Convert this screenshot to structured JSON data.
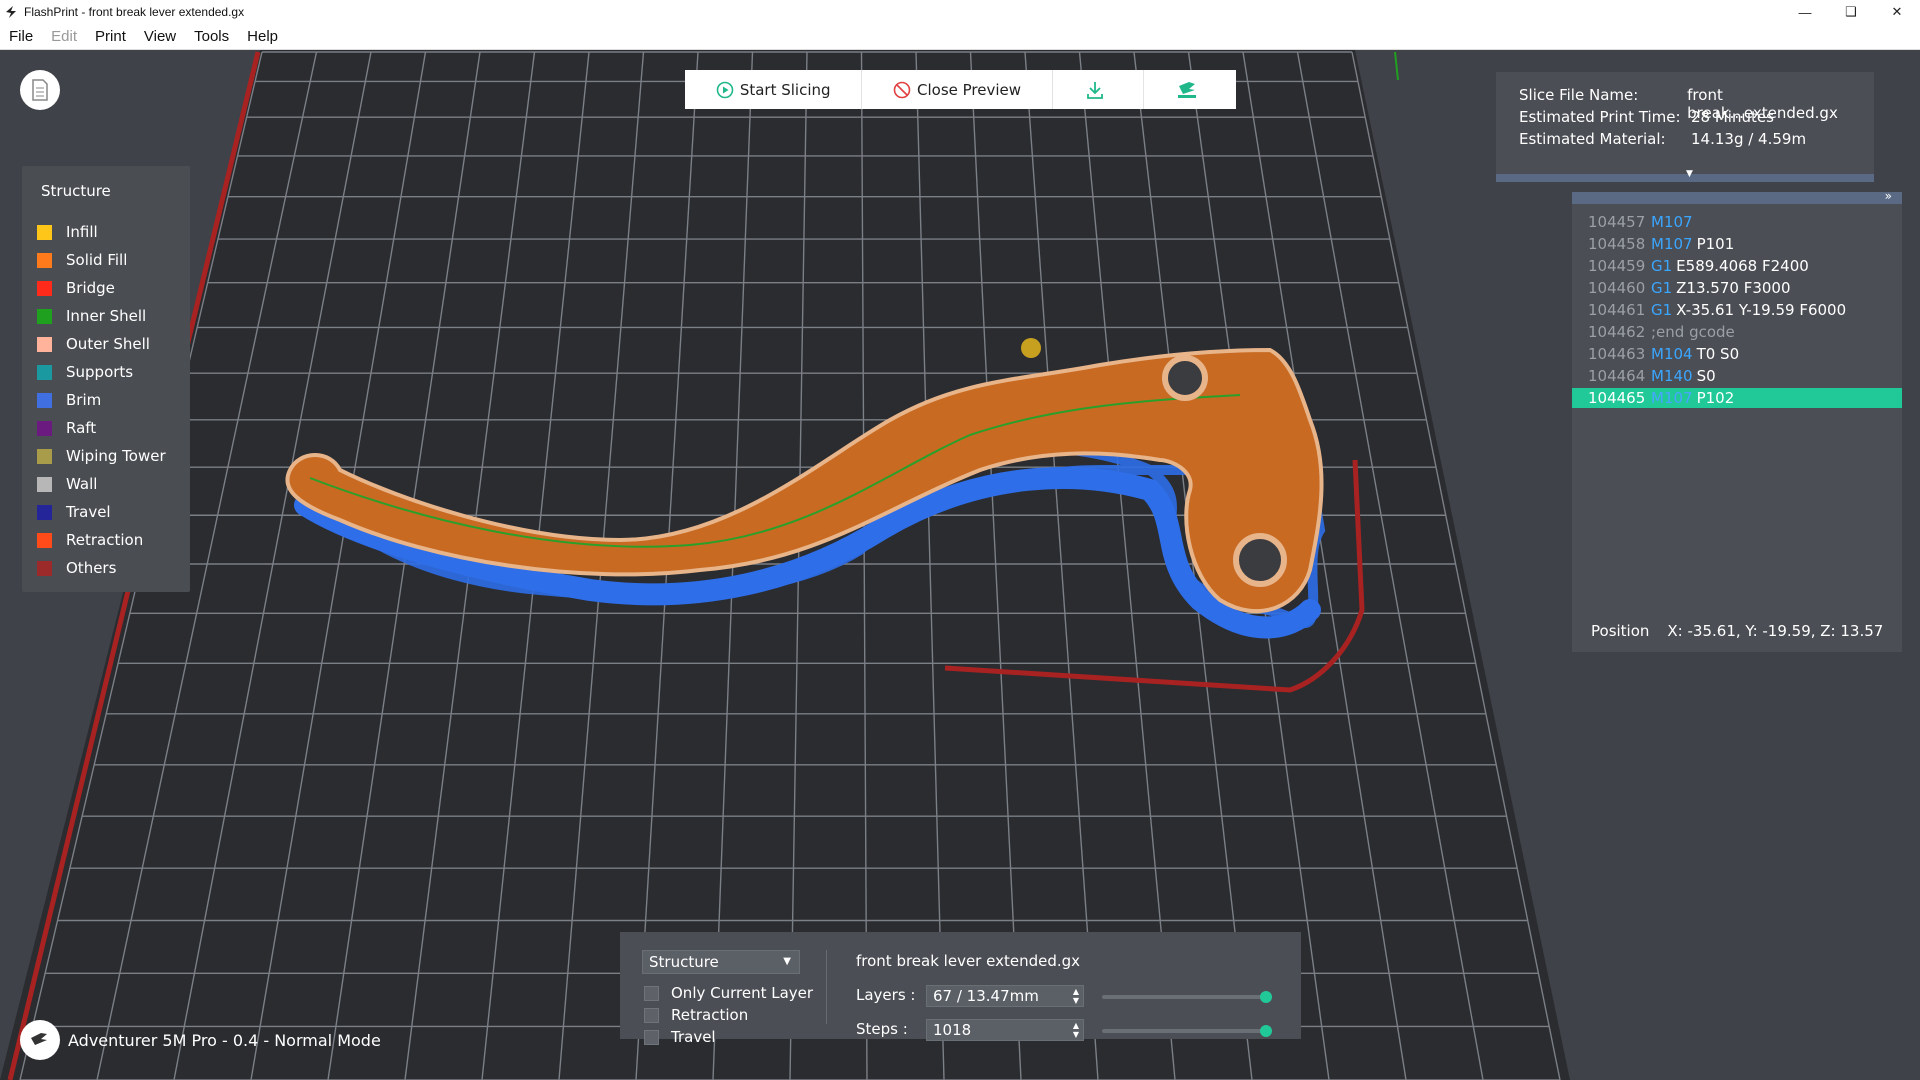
{
  "window": {
    "title": "FlashPrint - front break lever extended.gx",
    "controls": [
      "minimize",
      "restore",
      "close"
    ]
  },
  "menu": [
    "File",
    "Edit",
    "Print",
    "View",
    "Tools",
    "Help"
  ],
  "toolbar": {
    "start_slicing": "Start Slicing",
    "close_preview": "Close Preview",
    "export_icon": "download-icon",
    "print_icon": "print-send-icon"
  },
  "legend": {
    "title": "Structure",
    "items": [
      {
        "label": "Infill",
        "color": "#ffc61a"
      },
      {
        "label": "Solid Fill",
        "color": "#ff7a1a"
      },
      {
        "label": "Bridge",
        "color": "#ff2a1a"
      },
      {
        "label": "Inner Shell",
        "color": "#1fa01f"
      },
      {
        "label": "Outer Shell",
        "color": "#ffb39b"
      },
      {
        "label": "Supports",
        "color": "#1a9aa0"
      },
      {
        "label": "Brim",
        "color": "#3f6fe0"
      },
      {
        "label": "Raft",
        "color": "#6b1a7f"
      },
      {
        "label": "Wiping Tower",
        "color": "#a89c4a"
      },
      {
        "label": "Wall",
        "color": "#b7b7b7"
      },
      {
        "label": "Travel",
        "color": "#25259a"
      },
      {
        "label": "Retraction",
        "color": "#ff4a1a"
      },
      {
        "label": "Others",
        "color": "#9c2a2a"
      }
    ]
  },
  "info": {
    "file_name_label": "Slice File Name:",
    "file_name": "front break...extended.gx",
    "time_label": "Estimated Print Time:",
    "time": "28 Minutes",
    "material_label": "Estimated Material:",
    "material": "14.13g / 4.59m"
  },
  "gcode": {
    "lines": [
      {
        "num": "104457",
        "cmd": "M107",
        "args": ""
      },
      {
        "num": "104458",
        "cmd": "M107",
        "args": "P101"
      },
      {
        "num": "104459",
        "cmd": "G1",
        "args": "E589.4068 F2400"
      },
      {
        "num": "104460",
        "cmd": "G1",
        "args": "Z13.570 F3000"
      },
      {
        "num": "104461",
        "cmd": "G1",
        "args": "X-35.61 Y-19.59 F6000"
      },
      {
        "num": "104462",
        "cmd": "",
        "args": ";end gcode"
      },
      {
        "num": "104463",
        "cmd": "M104",
        "args": "T0 S0"
      },
      {
        "num": "104464",
        "cmd": "M140",
        "args": "S0"
      },
      {
        "num": "104465",
        "cmd": "M107",
        "args": "P102"
      }
    ],
    "position_label": "Position",
    "position_value": "X: -35.61, Y: -19.59, Z: 13.57"
  },
  "bottom": {
    "view_mode": "Structure",
    "checkboxes": [
      {
        "label": "Only Current Layer",
        "checked": false
      },
      {
        "label": "Retraction",
        "checked": false
      },
      {
        "label": "Travel",
        "checked": false
      }
    ],
    "file_name": "front break lever extended.gx",
    "layers_label": "Layers :",
    "layers_value": "67 / 13.47mm",
    "steps_label": "Steps :",
    "steps_value": "1018",
    "layers_slider_fraction": 1.0,
    "steps_slider_fraction": 1.0
  },
  "printer": {
    "label": "Adventurer 5M Pro - 0.4 - Normal Mode"
  },
  "colors": {
    "accent": "#20c997",
    "gcode_command": "#3ba6ff",
    "background": "#3f4248",
    "panel": "#4b4e54"
  }
}
